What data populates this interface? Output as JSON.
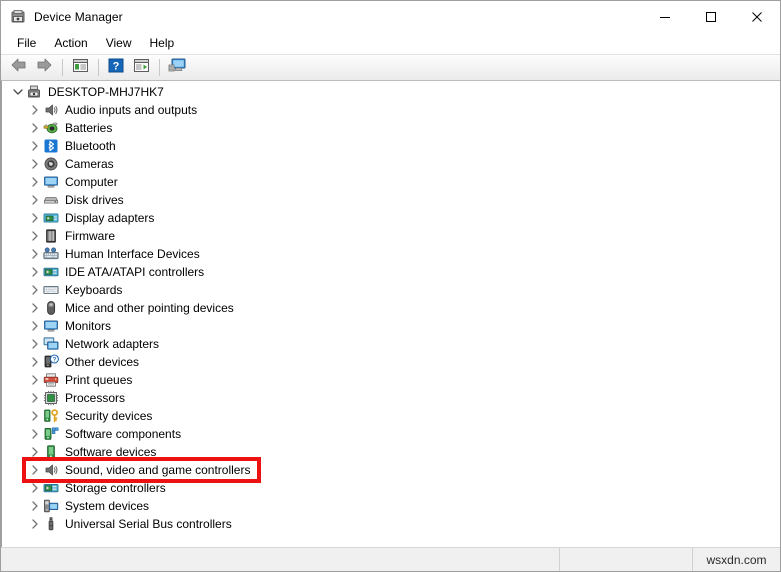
{
  "window": {
    "title": "Device Manager",
    "icon": "device-manager-icon",
    "caption_buttons": [
      {
        "name": "minimize",
        "glyph": "—"
      },
      {
        "name": "maximize",
        "glyph": "☐"
      },
      {
        "name": "close",
        "glyph": "✕"
      }
    ]
  },
  "menubar": {
    "items": [
      {
        "name": "file",
        "label": "File"
      },
      {
        "name": "action",
        "label": "Action"
      },
      {
        "name": "view",
        "label": "View"
      },
      {
        "name": "help",
        "label": "Help"
      }
    ]
  },
  "toolbar": {
    "buttons": [
      {
        "name": "back-button",
        "icon": "back-arrow-icon"
      },
      {
        "name": "forward-button",
        "icon": "forward-arrow-icon"
      },
      {
        "name": "show-hide-console-tree-button",
        "icon": "console-tree-icon"
      },
      {
        "name": "help-button",
        "icon": "help-question-icon"
      },
      {
        "name": "properties-button",
        "icon": "properties-icon"
      },
      {
        "name": "scan-hardware-changes-button",
        "icon": "scan-monitor-icon"
      }
    ]
  },
  "tree": {
    "root": {
      "label": "DESKTOP-MHJ7HK7",
      "icon": "computer-root-icon",
      "expanded": true
    },
    "items": [
      {
        "label": "Audio inputs and outputs",
        "icon": "speaker-icon"
      },
      {
        "label": "Batteries",
        "icon": "battery-icon"
      },
      {
        "label": "Bluetooth",
        "icon": "bluetooth-icon"
      },
      {
        "label": "Cameras",
        "icon": "camera-icon"
      },
      {
        "label": "Computer",
        "icon": "monitor-icon"
      },
      {
        "label": "Disk drives",
        "icon": "disk-drive-icon"
      },
      {
        "label": "Display adapters",
        "icon": "display-adapter-icon"
      },
      {
        "label": "Firmware",
        "icon": "firmware-chip-icon"
      },
      {
        "label": "Human Interface Devices",
        "icon": "hid-keyboard-icon"
      },
      {
        "label": "IDE ATA/ATAPI controllers",
        "icon": "ide-controller-icon"
      },
      {
        "label": "Keyboards",
        "icon": "keyboard-icon"
      },
      {
        "label": "Mice and other pointing devices",
        "icon": "mouse-icon"
      },
      {
        "label": "Monitors",
        "icon": "monitor-icon"
      },
      {
        "label": "Network adapters",
        "icon": "network-adapter-icon"
      },
      {
        "label": "Other devices",
        "icon": "other-device-question-icon"
      },
      {
        "label": "Print queues",
        "icon": "printer-icon"
      },
      {
        "label": "Processors",
        "icon": "processor-icon"
      },
      {
        "label": "Security devices",
        "icon": "security-key-icon"
      },
      {
        "label": "Software components",
        "icon": "software-component-icon"
      },
      {
        "label": "Software devices",
        "icon": "software-device-icon"
      },
      {
        "label": "Sound, video and game controllers",
        "icon": "speaker-icon",
        "highlighted": true
      },
      {
        "label": "Storage controllers",
        "icon": "storage-controller-icon"
      },
      {
        "label": "System devices",
        "icon": "system-device-icon"
      },
      {
        "label": "Universal Serial Bus controllers",
        "icon": "usb-icon"
      }
    ]
  },
  "highlight": {
    "color": "#ee1111",
    "target_label": "Sound, video and game controllers"
  },
  "statusbar": {
    "main_text": "",
    "mid_text": "",
    "watermark": "wsxdn.com"
  }
}
